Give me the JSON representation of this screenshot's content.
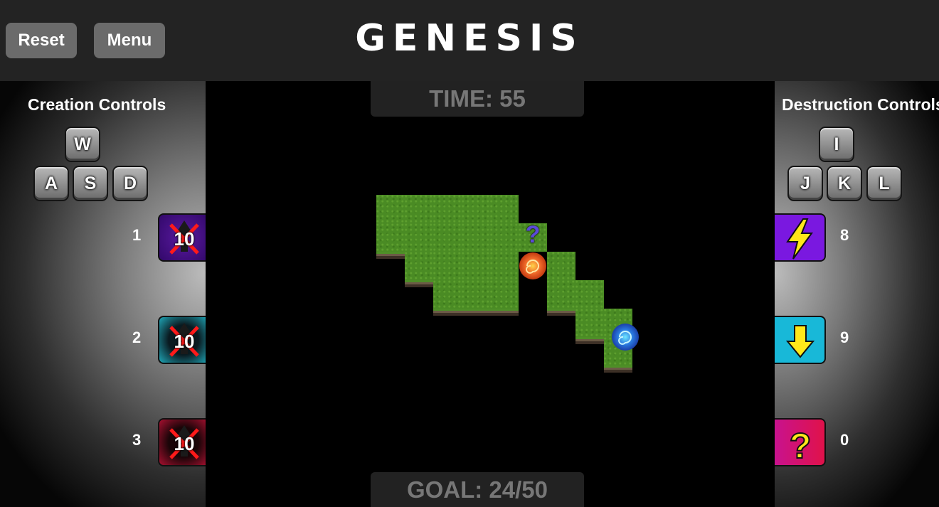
{
  "header": {
    "title": "GENESIS",
    "reset_label": "Reset",
    "menu_label": "Menu"
  },
  "creation": {
    "title": "Creation Controls",
    "keys": [
      "W",
      "A",
      "S",
      "D"
    ],
    "slots": [
      {
        "number": "1",
        "count": "10",
        "color": "purple",
        "locked": true
      },
      {
        "number": "2",
        "count": "10",
        "color": "teal",
        "locked": true
      },
      {
        "number": "3",
        "count": "10",
        "color": "crimson",
        "locked": true
      }
    ]
  },
  "destruction": {
    "title": "Destruction Controls",
    "keys": [
      "I",
      "J",
      "K",
      "L"
    ],
    "slots": [
      {
        "number": "8",
        "icon": "lightning-icon",
        "color": "#7a18e0"
      },
      {
        "number": "9",
        "icon": "arrow-down-icon",
        "color": "#18b8d8"
      },
      {
        "number": "0",
        "icon": "question-icon",
        "color": "#e0127a"
      }
    ]
  },
  "hud": {
    "time": "TIME: 55",
    "goal": "GOAL: 24/50"
  },
  "board": {
    "marker_glyph": "?",
    "colors": {
      "grass": "#4a8b24",
      "fire_orb": "#f06a2a",
      "water_orb": "#2a7ae0"
    }
  }
}
